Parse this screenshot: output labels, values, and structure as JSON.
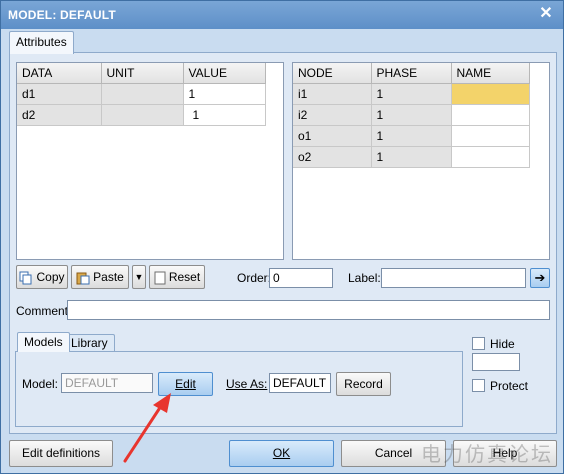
{
  "window": {
    "title": "MODEL: DEFAULT",
    "close_label": "✕"
  },
  "tabs": {
    "attributes": "Attributes"
  },
  "left_table": {
    "headers": [
      "DATA",
      "UNIT",
      "VALUE"
    ],
    "rows": [
      [
        "d1",
        "",
        "1"
      ],
      [
        "d2",
        "",
        "1"
      ]
    ]
  },
  "right_table": {
    "headers": [
      "NODE",
      "PHASE",
      "NAME"
    ],
    "rows": [
      [
        "i1",
        "1",
        ""
      ],
      [
        "i2",
        "1",
        ""
      ],
      [
        "o1",
        "1",
        ""
      ],
      [
        "o2",
        "1",
        ""
      ]
    ]
  },
  "toolbar": {
    "copy": "Copy",
    "paste": "Paste",
    "reset": "Reset",
    "order_label": "Order:",
    "order_value": "0",
    "label_label": "Label:",
    "label_value": ""
  },
  "comment": {
    "label": "Comment:",
    "value": ""
  },
  "subtabs": {
    "models": "Models",
    "library": "Library"
  },
  "model": {
    "label": "Model:",
    "value": "DEFAULT",
    "edit": "Edit",
    "use_as_label": "Use As:",
    "use_as_value": "DEFAULT",
    "record": "Record"
  },
  "options": {
    "hide": "Hide",
    "hide_value": "",
    "protect": "Protect"
  },
  "footer": {
    "edit_definitions": "Edit definitions",
    "ok": "OK",
    "cancel": "Cancel",
    "help": "Help"
  },
  "watermark": "电力仿真论坛",
  "colors": {
    "selected_cell": "#f3d36a",
    "titlebar": "#6b9bd0",
    "annotation_arrow": "#e8352e"
  }
}
